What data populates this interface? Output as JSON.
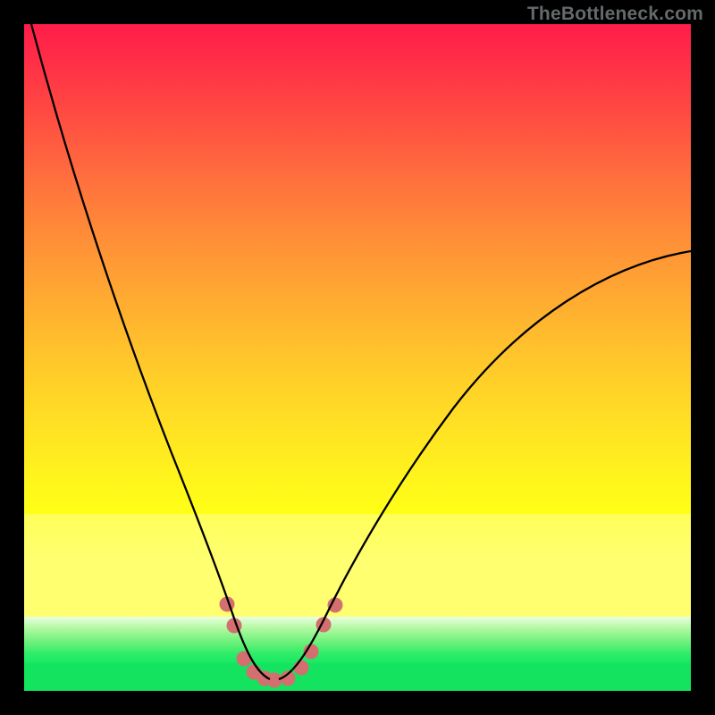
{
  "watermark": "TheBottleneck.com",
  "chart_data": {
    "type": "line",
    "title": "",
    "xlabel": "",
    "ylabel": "",
    "xlim": [
      0,
      100
    ],
    "ylim": [
      0,
      100
    ],
    "grid": false,
    "legend": false,
    "background_gradient": {
      "stops": [
        {
          "pos": 0.0,
          "color": "#ff1d49"
        },
        {
          "pos": 0.35,
          "color": "#ff8a38"
        },
        {
          "pos": 0.7,
          "color": "#ffe124"
        },
        {
          "pos": 0.8,
          "color": "#ffff6f"
        },
        {
          "pos": 0.92,
          "color": "#5ff07a"
        },
        {
          "pos": 1.0,
          "color": "#14e360"
        }
      ]
    },
    "series": [
      {
        "name": "left-branch",
        "color": "#000000",
        "x": [
          1,
          5,
          10,
          15,
          20,
          24,
          27,
          29,
          30.5,
          31.5,
          32.5,
          33.5,
          35,
          36.5
        ],
        "y": [
          100,
          88,
          73,
          59,
          45,
          33,
          24,
          17,
          12,
          9,
          6,
          4,
          2.5,
          2
        ]
      },
      {
        "name": "right-branch",
        "color": "#000000",
        "x": [
          38,
          40,
          42,
          45,
          49,
          54,
          60,
          67,
          75,
          84,
          92,
          100
        ],
        "y": [
          2,
          3,
          6,
          11,
          18,
          26,
          34,
          42,
          50,
          57,
          62,
          66
        ]
      },
      {
        "name": "markers",
        "type": "scatter",
        "color": "#d46f6f",
        "marker_radius": 8,
        "x": [
          30.5,
          31.5,
          33,
          34.5,
          36,
          37.5,
          39.5,
          41.5,
          43,
          45,
          47
        ],
        "y": [
          13,
          10,
          5,
          3,
          2,
          2,
          2,
          3.5,
          6,
          10,
          13
        ]
      }
    ],
    "annotations": []
  }
}
